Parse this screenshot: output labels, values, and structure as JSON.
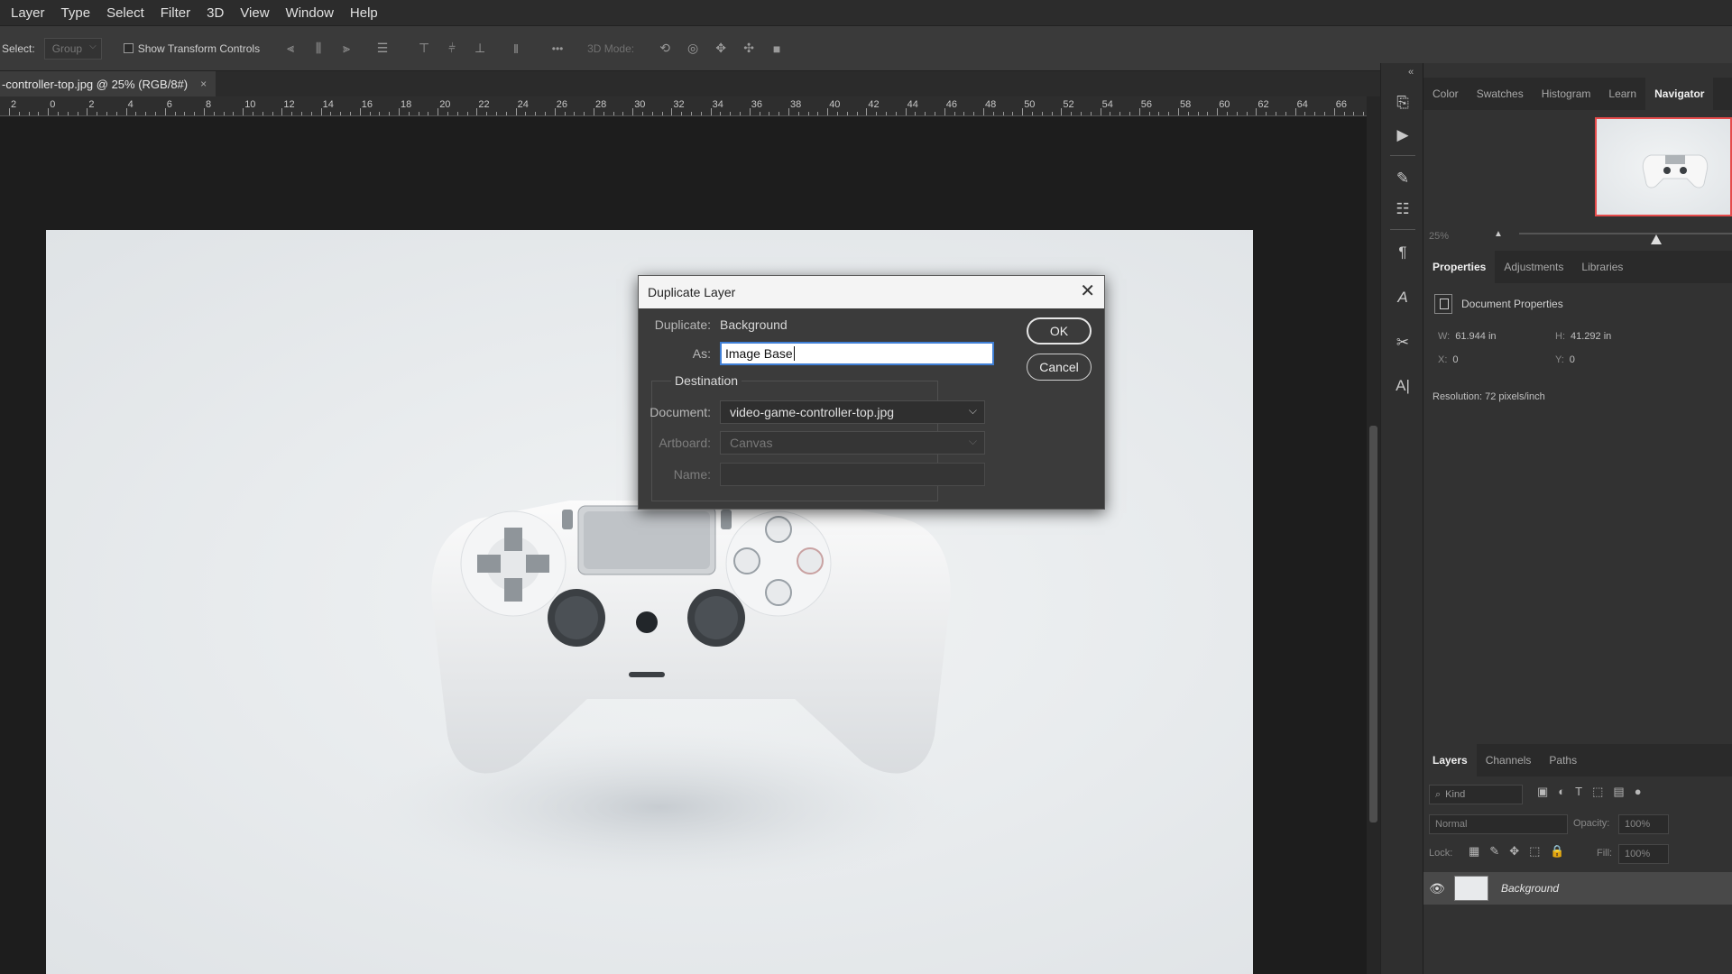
{
  "menu": [
    "Layer",
    "Type",
    "Select",
    "Filter",
    "3D",
    "View",
    "Window",
    "Help"
  ],
  "options": {
    "select_label": "Select:",
    "select_value": "Group",
    "transform_label": "Show Transform Controls",
    "mode_3d_label": "3D Mode:",
    "more_label": "•••"
  },
  "document": {
    "tab_title": "-controller-top.jpg @ 25% (RGB/8#)",
    "close_glyph": "×",
    "ruler_labels": [
      "2",
      "0",
      "2",
      "4",
      "6",
      "8",
      "10",
      "12",
      "14",
      "16",
      "18",
      "20",
      "22",
      "24",
      "26",
      "28",
      "30",
      "32",
      "34",
      "36",
      "38",
      "40",
      "42",
      "44",
      "46",
      "48",
      "50",
      "52",
      "54",
      "56",
      "58",
      "60",
      "62",
      "64",
      "66"
    ]
  },
  "dialog": {
    "title": "Duplicate Layer",
    "duplicate_label": "Duplicate:",
    "duplicate_value": "Background",
    "as_label": "As:",
    "as_value": "Image Base",
    "destination_label": "Destination",
    "document_label": "Document:",
    "document_value": "video-game-controller-top.jpg",
    "artboard_label": "Artboard:",
    "artboard_value": "Canvas",
    "name_label": "Name:",
    "name_value": "",
    "ok_label": "OK",
    "cancel_label": "Cancel"
  },
  "panels": {
    "top_tabs": [
      "Color",
      "Swatches",
      "Histogram",
      "Learn",
      "Navigator"
    ],
    "active_top_tab": "Navigator",
    "zoom": "25%",
    "props_tabs": [
      "Properties",
      "Adjustments",
      "Libraries"
    ],
    "props_title": "Document Properties",
    "w_label": "W:",
    "w_value": "61.944 in",
    "h_label": "H:",
    "h_value": "41.292 in",
    "x_label": "X:",
    "x_value": "0",
    "y_label": "Y:",
    "y_value": "0",
    "resolution": "Resolution: 72 pixels/inch",
    "layers_tabs": [
      "Layers",
      "Channels",
      "Paths"
    ],
    "kind_label": "Kind",
    "blend_mode": "Normal",
    "opacity_label": "Opacity:",
    "opacity_value": "100%",
    "lock_label": "Lock:",
    "fill_label": "Fill:",
    "fill_value": "100%",
    "layer_name": "Background"
  }
}
